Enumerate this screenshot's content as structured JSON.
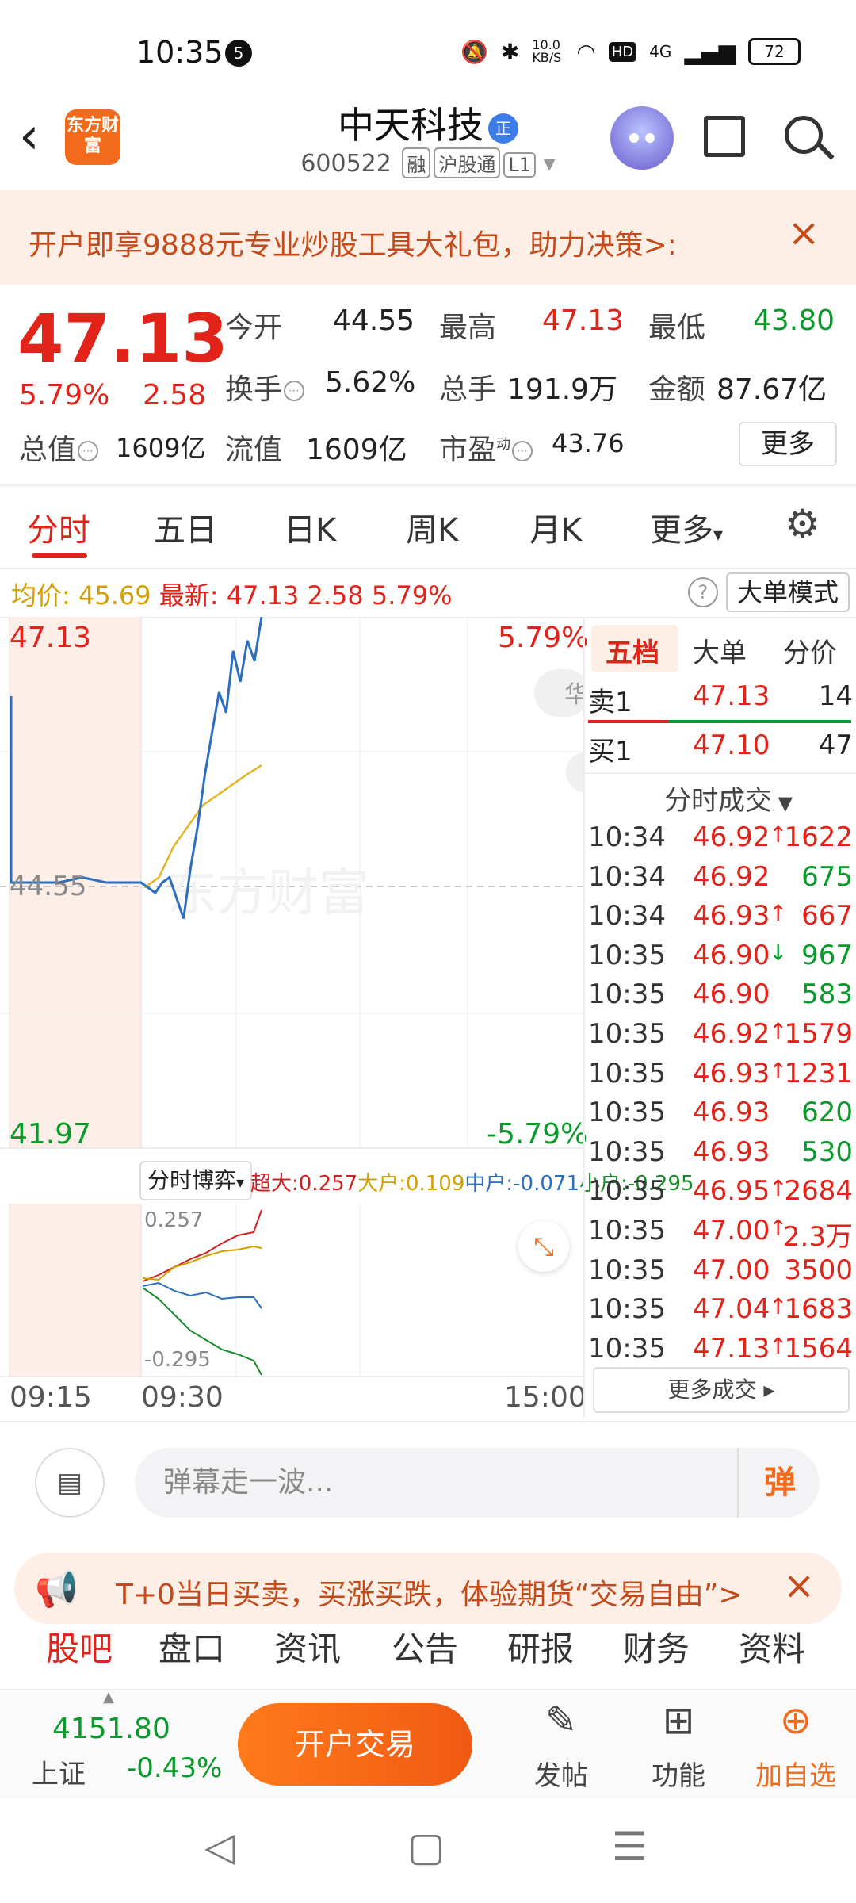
{
  "status_bar": {
    "time": "10:35",
    "notification_count": "5",
    "net_speed": "10.0 KB/S",
    "signal": "4G",
    "battery": "72"
  },
  "header": {
    "logo_text": "东方财富",
    "stock_name": "中天科技",
    "badge": "正",
    "stock_code": "600522",
    "tags": [
      "融",
      "沪股通",
      "L1"
    ]
  },
  "banner": {
    "text": "开户即享9888元专业炒股工具大礼包，助力决策>:",
    "close": "×"
  },
  "quote": {
    "price": "47.13",
    "change_pct": "5.79%",
    "change": "2.58",
    "open_label": "今开",
    "open": "44.55",
    "high_label": "最高",
    "high": "47.13",
    "low_label": "最低",
    "low": "43.80",
    "turnover_label": "换手",
    "turnover": "5.62%",
    "volume_label": "总手",
    "volume": "191.9万",
    "amount_label": "金额",
    "amount": "87.67亿",
    "mcap_label": "总值",
    "mcap": "1609亿",
    "float_label": "流值",
    "float_cap": "1609亿",
    "pe_label": "市盈",
    "pe_sup": "动",
    "pe": "43.76",
    "more": "更多"
  },
  "chart_tabs": [
    "分时",
    "五日",
    "日K",
    "周K",
    "月K",
    "更多"
  ],
  "avg_bar": {
    "avg_label": "均价:",
    "avg": "45.69",
    "latest_label": "最新:",
    "latest": "47.13",
    "chg": "2.58",
    "pct": "5.79%",
    "mode_button": "大单模式"
  },
  "chart": {
    "top_price": "47.13",
    "top_pct": "5.79%",
    "mid_price": "44.55",
    "bottom_price": "41.97",
    "bottom_pct": "-5.79%",
    "watermark": "东方财富",
    "side_label": "华"
  },
  "chart_data": {
    "type": "line",
    "series": [
      {
        "values": [
          44.55,
          44.5,
          44.45,
          44.55,
          44.6,
          44.4,
          44.2,
          44.7,
          45.1,
          45.6,
          46.0,
          46.4,
          46.2,
          46.8,
          46.5,
          46.9,
          46.7,
          47.13
        ]
      },
      {
        "values": [
          44.5,
          44.6,
          44.9,
          45.1,
          45.3,
          45.4,
          45.5,
          45.6,
          45.69
        ]
      }
    ],
    "ylim": [
      41.97,
      47.13
    ]
  },
  "sub_chart": {
    "selector": "分时博弈",
    "legend": [
      {
        "label": "超大:0.257",
        "color": "#d02020"
      },
      {
        "label": "大户:0.109",
        "color": "#d4a000"
      },
      {
        "label": "中户:-0.071",
        "color": "#2a6fc0"
      },
      {
        "label": "小户:-0.295",
        "color": "#1a8a2a"
      }
    ],
    "top": "0.257",
    "bottom": "-0.295"
  },
  "time_axis": [
    "09:15",
    "09:30",
    "15:00"
  ],
  "right_panel": {
    "tabs": [
      "五档",
      "大单",
      "分价"
    ],
    "sell1": {
      "label": "卖1",
      "price": "47.13",
      "vol": "14"
    },
    "buy1": {
      "label": "买1",
      "price": "47.10",
      "vol": "47"
    },
    "trades_title": "分时成交",
    "trades": [
      {
        "t": "10:34",
        "p": "46.92",
        "arrow": "↑",
        "v": "1622",
        "vc": "red"
      },
      {
        "t": "10:34",
        "p": "46.92",
        "arrow": "",
        "v": "675",
        "vc": "green"
      },
      {
        "t": "10:34",
        "p": "46.93",
        "arrow": "↑",
        "v": "667",
        "vc": "red"
      },
      {
        "t": "10:35",
        "p": "46.90",
        "arrow": "↓",
        "v": "967",
        "vc": "green"
      },
      {
        "t": "10:35",
        "p": "46.90",
        "arrow": "",
        "v": "583",
        "vc": "green"
      },
      {
        "t": "10:35",
        "p": "46.92",
        "arrow": "↑",
        "v": "1579",
        "vc": "red"
      },
      {
        "t": "10:35",
        "p": "46.93",
        "arrow": "↑",
        "v": "1231",
        "vc": "red"
      },
      {
        "t": "10:35",
        "p": "46.93",
        "arrow": "",
        "v": "620",
        "vc": "green"
      },
      {
        "t": "10:35",
        "p": "46.93",
        "arrow": "",
        "v": "530",
        "vc": "green"
      },
      {
        "t": "10:35",
        "p": "46.95",
        "arrow": "↑",
        "v": "2684",
        "vc": "red"
      },
      {
        "t": "10:35",
        "p": "47.00",
        "arrow": "↑",
        "v": "2.3万",
        "vc": "red"
      },
      {
        "t": "10:35",
        "p": "47.00",
        "arrow": "",
        "v": "3500",
        "vc": "red"
      },
      {
        "t": "10:35",
        "p": "47.04",
        "arrow": "↑",
        "v": "1683",
        "vc": "red"
      },
      {
        "t": "10:35",
        "p": "47.13",
        "arrow": "↑",
        "v": "1564",
        "vc": "red"
      }
    ],
    "more_trades": "更多成交 ▸"
  },
  "comment": {
    "placeholder": "弹幕走一波...",
    "dan": "弹"
  },
  "promo": {
    "text": "T+0当日买卖，买涨买跌，体验期货“交易自由”>",
    "close": "×"
  },
  "section_tabs": [
    "股吧",
    "盘口",
    "资讯",
    "公告",
    "研报",
    "财务",
    "资料"
  ],
  "bottom_bar": {
    "index_value": "4151.80",
    "index_name": "上证",
    "index_pct": "-0.43%",
    "open_trade": "开户交易",
    "post": "发帖",
    "functions": "功能",
    "add_watch": "加自选"
  },
  "nav": {
    "back": "◁",
    "home": "▢",
    "menu": "☰"
  }
}
